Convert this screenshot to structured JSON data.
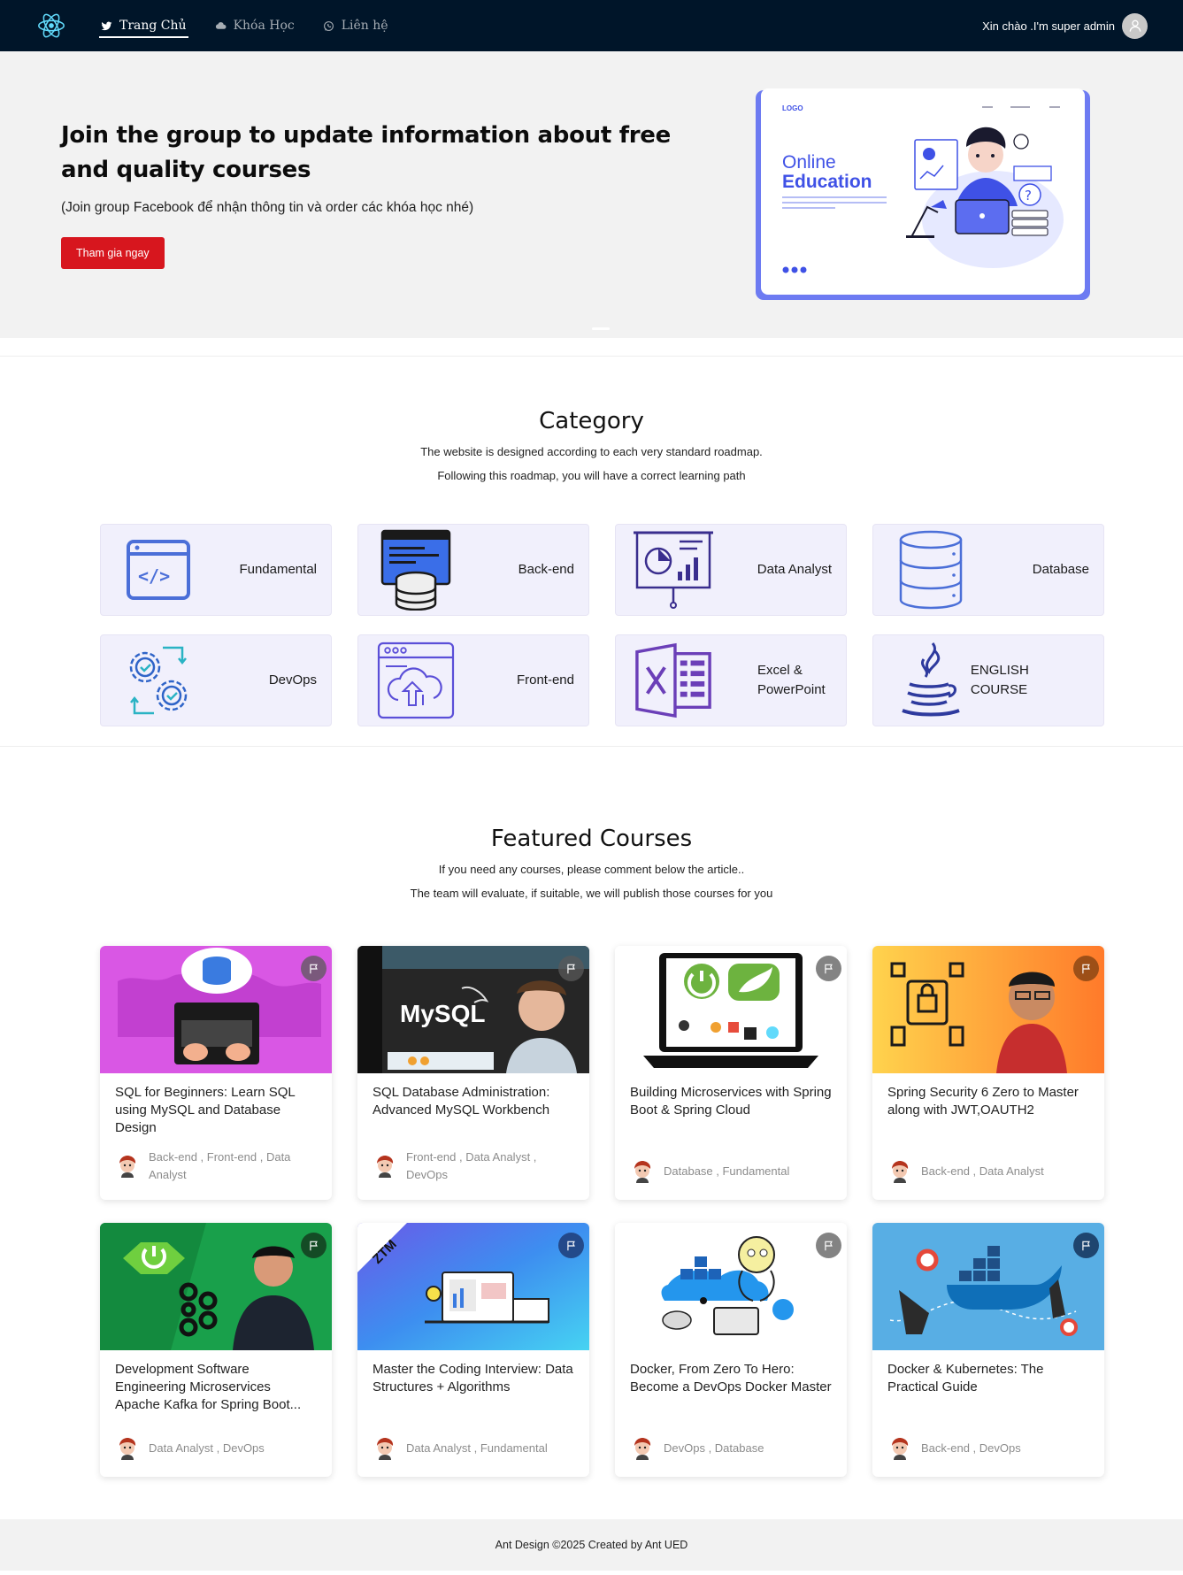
{
  "nav": {
    "menu": [
      {
        "label": "Trang Chủ",
        "icon": "twitter-icon",
        "active": true
      },
      {
        "label": "Khóa Học",
        "icon": "cloud-icon",
        "active": false
      },
      {
        "label": "Liên hệ",
        "icon": "whatsapp-icon",
        "active": false
      }
    ],
    "greeting": "Xin chào .I'm super admin"
  },
  "hero": {
    "title": "Join the group to update information about free and quality courses",
    "subtitle": "(Join group Facebook để nhận thông tin và order các khóa học nhé)",
    "cta": "Tham gia ngay",
    "illustration": {
      "logo": "LOGO",
      "heading_line1": "Online",
      "heading_line2": "Education"
    }
  },
  "category": {
    "title": "Category",
    "desc_line1": "The website is designed according to each very standard roadmap.",
    "desc_line2": "Following this roadmap, you will have a correct learning path",
    "items": [
      {
        "label": "Fundamental",
        "icon": "code-window-icon"
      },
      {
        "label": "Back-end",
        "icon": "server-database-icon"
      },
      {
        "label": "Data Analyst",
        "icon": "presentation-chart-icon"
      },
      {
        "label": "Database",
        "icon": "database-icon"
      },
      {
        "label": "DevOps",
        "icon": "gears-cycle-icon"
      },
      {
        "label": "Front-end",
        "icon": "cloud-upload-window-icon"
      },
      {
        "label": "Excel & PowerPoint",
        "icon": "excel-icon"
      },
      {
        "label": "ENGLISH COURSE",
        "icon": "java-cup-icon"
      }
    ]
  },
  "featured": {
    "title": "Featured Courses",
    "desc_line1": "If you need any courses, please comment below the article..",
    "desc_line2": "The team will evaluate, if suitable, we will publish those courses for you",
    "courses": [
      {
        "title": "SQL for Beginners: Learn SQL using MySQL and Database Design",
        "tags": "Back-end , Front-end , Data Analyst",
        "thumb_color": "#d24bd8",
        "thumb": "sql-laptop-thumb"
      },
      {
        "title": "SQL Database Administration: Advanced MySQL Workbench",
        "tags": "Front-end , Data Analyst , DevOps",
        "thumb_color": "#1e1e1e",
        "thumb": "mysql-thumb",
        "thumb_text": "MySQL"
      },
      {
        "title": "Building Microservices with Spring Boot & Spring Cloud",
        "tags": "Database , Fundamental",
        "thumb_color": "#ffffff",
        "thumb": "spring-laptop-thumb"
      },
      {
        "title": "Spring Security 6 Zero to Master along with JWT,OAUTH2",
        "tags": "Back-end , Data Analyst",
        "thumb_color": "#f6b23a",
        "thumb": "security-thumb"
      },
      {
        "title": "Development Software Engineering Microservices Apache Kafka for Spring Boot...",
        "tags": "Data Analyst , DevOps",
        "thumb_color": "#1aa24a",
        "thumb": "kafka-thumb"
      },
      {
        "title": "Master the Coding Interview: Data Structures + Algorithms",
        "tags": "Data Analyst , Fundamental",
        "thumb_color": "#3b9cf0",
        "thumb": "coding-interview-thumb",
        "thumb_text": "ZTM"
      },
      {
        "title": "Docker, From Zero To Hero: Become a DevOps Docker Master",
        "tags": "DevOps , Database",
        "thumb_color": "#ffffff",
        "thumb": "docker-thumb"
      },
      {
        "title": "Docker & Kubernetes: The Practical Guide",
        "tags": "Back-end , DevOps",
        "thumb_color": "#56a9df",
        "thumb": "docker-whale-thumb"
      }
    ]
  },
  "footer": {
    "text": "Ant Design ©2025 Created by Ant UED"
  }
}
